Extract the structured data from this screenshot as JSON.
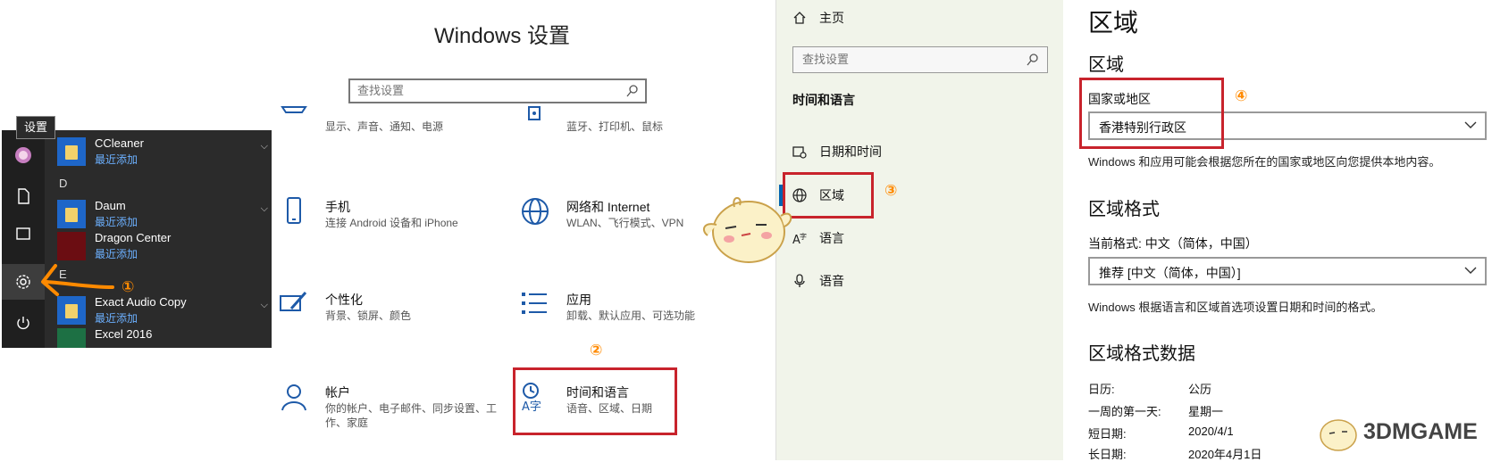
{
  "start_menu": {
    "tooltip": "设置",
    "letter_d": "D",
    "letter_e": "E",
    "apps": [
      {
        "name": "CCleaner",
        "sub": "最近添加"
      },
      {
        "name": "Daum",
        "sub": "最近添加"
      },
      {
        "name": "Dragon Center",
        "sub": "最近添加"
      },
      {
        "name": "Exact Audio Copy",
        "sub": "最近添加"
      },
      {
        "name": "Excel 2016",
        "sub": ""
      }
    ],
    "rail_icons": [
      "user-avatar-icon",
      "document-icon",
      "pictures-icon",
      "settings-gear-icon",
      "power-icon"
    ]
  },
  "annotations": {
    "step1": "①",
    "step2": "②",
    "step3": "③",
    "step4": "④",
    "accent": "#ff8a00",
    "box_color": "#c8232c"
  },
  "settings": {
    "title": "Windows 设置",
    "search_placeholder": "查找设置",
    "categories": [
      {
        "title": "",
        "desc": "显示、声音、通知、电源",
        "icon": "system-icon"
      },
      {
        "title": "",
        "desc": "蓝牙、打印机、鼠标",
        "icon": "devices-icon"
      },
      {
        "title": "手机",
        "desc": "连接 Android 设备和 iPhone",
        "icon": "phone-icon"
      },
      {
        "title": "网络和 Internet",
        "desc": "WLAN、飞行模式、VPN",
        "icon": "globe-icon"
      },
      {
        "title": "个性化",
        "desc": "背景、锁屏、颜色",
        "icon": "personalization-icon"
      },
      {
        "title": "应用",
        "desc": "卸载、默认应用、可选功能",
        "icon": "apps-icon"
      },
      {
        "title": "帐户",
        "desc": "你的帐户、电子邮件、同步设置、工作、家庭",
        "icon": "account-icon"
      },
      {
        "title": "时间和语言",
        "desc": "语音、区域、日期",
        "icon": "time-language-icon"
      }
    ]
  },
  "nav": {
    "home": "主页",
    "search_placeholder": "查找设置",
    "section": "时间和语言",
    "items": [
      "日期和时间",
      "区域",
      "语言",
      "语音"
    ],
    "active": "区域"
  },
  "region": {
    "page_title": "区域",
    "section1": "区域",
    "country_label": "国家或地区",
    "country_value": "香港特别行政区",
    "country_help": "Windows 和应用可能会根据您所在的国家或地区向您提供本地内容。",
    "section2": "区域格式",
    "format_label": "当前格式: 中文（简体，中国）",
    "format_value": "推荐 [中文（简体，中国）]",
    "format_help": "Windows 根据语言和区域首选项设置日期和时间的格式。",
    "section3": "区域格式数据",
    "data_rows": [
      {
        "label": "日历:",
        "value": "公历"
      },
      {
        "label": "一周的第一天:",
        "value": "星期一"
      },
      {
        "label": "短日期:",
        "value": "2020/4/1"
      },
      {
        "label": "长日期:",
        "value": "2020年4月1日"
      }
    ]
  },
  "watermark": {
    "text": "3DMGAME"
  }
}
